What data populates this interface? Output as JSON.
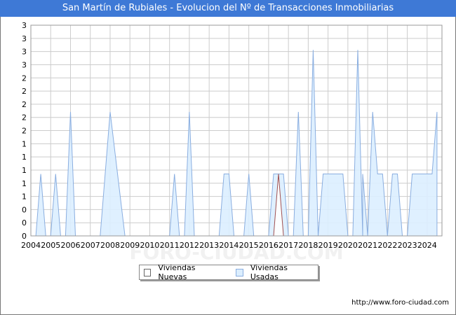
{
  "title": "San Martín de Rubiales - Evolucion del Nº de Transacciones Inmobiliarias",
  "footer": "http://www.foro-ciudad.com",
  "watermark": "FORO-CIUDAD.COM",
  "colors": {
    "title_bg": "#3e79d6",
    "usadas_fill": "#dbeeff",
    "usadas_stroke": "#8aaee0",
    "nuevas_fill": "#ffffff",
    "nuevas_stroke": "#a05050",
    "grid": "#cccccc"
  },
  "chart_data": {
    "type": "area",
    "title": "San Martín de Rubiales - Evolucion del Nº de Transacciones Inmobiliarias",
    "x_tick_labels": [
      "2004",
      "2005",
      "2006",
      "2007",
      "2008",
      "2009",
      "2010",
      "2011",
      "2012",
      "2013",
      "2014",
      "2015",
      "2016",
      "2017",
      "2018",
      "2019",
      "2020",
      "2021",
      "2022",
      "2023",
      "2024"
    ],
    "y_tick_labels": [
      "0",
      "0",
      "0",
      "1",
      "1",
      "1",
      "1",
      "1",
      "2",
      "2",
      "2",
      "2",
      "2",
      "3",
      "3",
      "3",
      "3"
    ],
    "ylim": [
      0,
      3.4
    ],
    "xlim": [
      2004.0,
      2024.75
    ],
    "grid": true,
    "legend_position": "bottom",
    "series": [
      {
        "name": "Viviendas Nuevas",
        "points": [
          [
            2016.25,
            0
          ],
          [
            2016.5,
            1
          ],
          [
            2016.75,
            0
          ]
        ]
      },
      {
        "name": "Viviendas Usadas",
        "points": [
          [
            2004.25,
            0
          ],
          [
            2004.5,
            1
          ],
          [
            2004.75,
            0
          ],
          [
            2005.0,
            0
          ],
          [
            2005.25,
            1
          ],
          [
            2005.5,
            0
          ],
          [
            2005.75,
            0
          ],
          [
            2006.0,
            2
          ],
          [
            2006.25,
            0
          ],
          [
            2007.5,
            0
          ],
          [
            2008.0,
            2
          ],
          [
            2008.75,
            0
          ],
          [
            2011.0,
            0
          ],
          [
            2011.25,
            1
          ],
          [
            2011.5,
            0
          ],
          [
            2011.75,
            0
          ],
          [
            2012.0,
            2
          ],
          [
            2012.25,
            0
          ],
          [
            2013.5,
            0
          ],
          [
            2013.75,
            1
          ],
          [
            2014.0,
            1
          ],
          [
            2014.25,
            0
          ],
          [
            2014.75,
            0
          ],
          [
            2015.0,
            1
          ],
          [
            2015.25,
            0
          ],
          [
            2016.0,
            0
          ],
          [
            2016.25,
            1
          ],
          [
            2016.75,
            1
          ],
          [
            2017.0,
            0
          ],
          [
            2017.25,
            0
          ],
          [
            2017.5,
            2
          ],
          [
            2017.75,
            0
          ],
          [
            2018.0,
            0
          ],
          [
            2018.25,
            3
          ],
          [
            2018.5,
            0
          ],
          [
            2018.75,
            1
          ],
          [
            2019.0,
            1
          ],
          [
            2019.75,
            1
          ],
          [
            2020.0,
            0
          ],
          [
            2020.25,
            0
          ],
          [
            2020.5,
            3
          ],
          [
            2020.75,
            0
          ],
          [
            2020.75,
            1
          ],
          [
            2021.0,
            0
          ],
          [
            2021.25,
            2
          ],
          [
            2021.5,
            1
          ],
          [
            2021.75,
            1
          ],
          [
            2022.0,
            0
          ],
          [
            2022.25,
            1
          ],
          [
            2022.5,
            1
          ],
          [
            2022.75,
            0
          ],
          [
            2023.0,
            0
          ],
          [
            2023.25,
            1
          ],
          [
            2024.0,
            1
          ],
          [
            2024.25,
            1
          ],
          [
            2024.5,
            2
          ]
        ]
      }
    ]
  }
}
